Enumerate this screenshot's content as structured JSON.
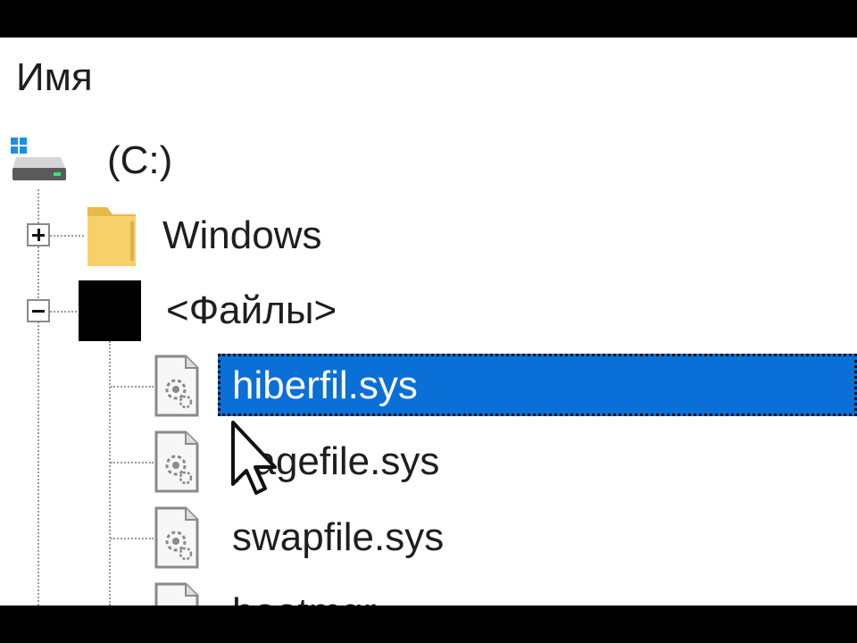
{
  "header": {
    "name_column": "Имя"
  },
  "tree": {
    "drive": {
      "label": "(C:)",
      "icon": "drive-icon"
    },
    "windows": {
      "label": "Windows",
      "icon": "folder-icon",
      "expanded": false
    },
    "files_group": {
      "label": "<Файлы>",
      "icon": "black-square-icon",
      "expanded": true
    },
    "files": [
      {
        "label": "hiberfil.sys",
        "selected": true
      },
      {
        "label": "pagefile.sys",
        "selected": false
      },
      {
        "label": "swapfile.sys",
        "selected": false
      },
      {
        "label": "bootmgr",
        "selected": false
      }
    ]
  },
  "colors": {
    "selection": "#0a6fd6",
    "folder": "#f6d069",
    "background": "#ffffff"
  }
}
